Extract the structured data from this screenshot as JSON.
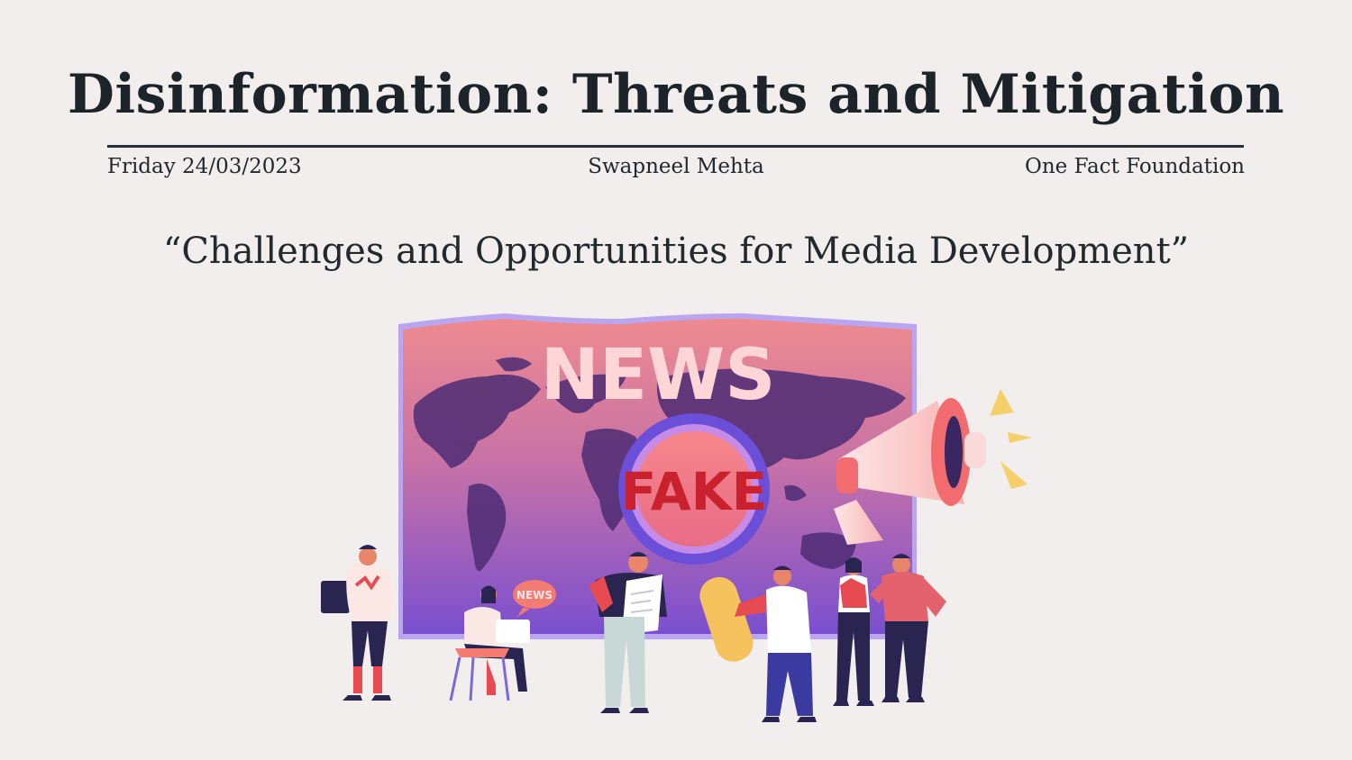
{
  "slide": {
    "title": "Disinformation: Threats and Mitigation",
    "date": "Friday 24/03/2023",
    "author": "Swapneel Mehta",
    "organization": "One Fact Foundation",
    "subtitle": "“Challenges and Opportunities for Media Development”"
  },
  "illustration": {
    "banner_text": "NEWS",
    "lens_text": "FAKE",
    "bubble_text": "NEWS",
    "colors": {
      "banner_top": "#ee8a90",
      "banner_bottom": "#7a4fcf",
      "map": "#4e2c74",
      "lens_ring": "#6b4fd8",
      "lens_fill": "#f0707c",
      "fake_text": "#c9222e",
      "news_text": "#ffd6d8",
      "megaphone": "#f26b6e",
      "accent_yellow": "#f6cf6a"
    }
  }
}
